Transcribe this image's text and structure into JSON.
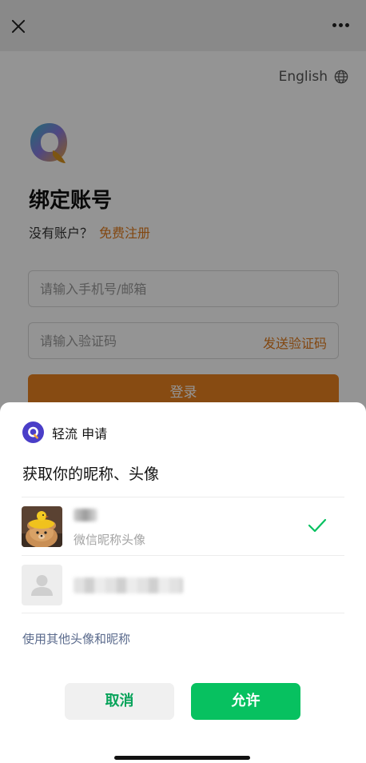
{
  "page": {
    "language_label": "English",
    "heading": "绑定账号",
    "no_account_text": "没有账户？",
    "register_link": "免费注册",
    "phone_placeholder": "请输入手机号/邮箱",
    "code_placeholder": "请输入验证码",
    "send_code_label": "发送验证码",
    "login_label": "登录"
  },
  "sheet": {
    "app_name": "轻流 申请",
    "request_title": "获取你的昵称、头像",
    "option1_subtitle": "微信昵称头像",
    "other_link": "使用其他头像和昵称",
    "cancel_label": "取消",
    "allow_label": "允许"
  },
  "colors": {
    "accent_orange": "#e8821f",
    "wechat_green": "#07c160",
    "link_blue": "#5a6a8c"
  },
  "icons": [
    "close-icon",
    "more-icon",
    "globe-icon",
    "qingliu-logo",
    "check-icon",
    "default-avatar-icon"
  ]
}
